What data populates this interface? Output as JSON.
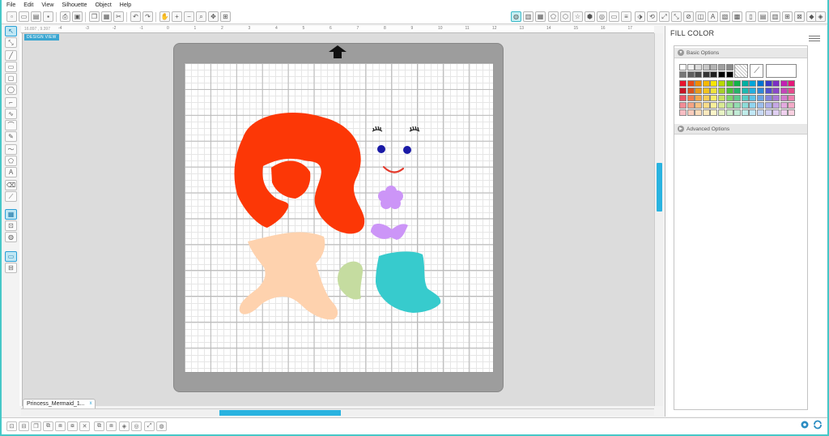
{
  "menu": [
    "File",
    "Edit",
    "View",
    "Silhouette",
    "Object",
    "Help"
  ],
  "ruler": {
    "coords": "16.897 , 9.397",
    "ticks": [
      "-4",
      "-3",
      "-2",
      "-1",
      "0",
      "1",
      "2",
      "3",
      "4",
      "5",
      "6",
      "7",
      "8",
      "9",
      "10",
      "11",
      "12",
      "13",
      "14",
      "15",
      "16",
      "17"
    ]
  },
  "design_view_label": "DESIGN VIEW",
  "document_tab": {
    "name": "Princess_Mermaid_1...",
    "close": "x"
  },
  "panel": {
    "title": "FILL COLOR",
    "basic_options": "Basic Options",
    "advanced_options": "Advanced Options"
  },
  "colors": {
    "accent": "#46c8c8",
    "scroll": "#29b3e0",
    "hair": "#fc3706",
    "skin": "#fed2ae",
    "tail": "#37cbcd",
    "fin": "#c5dca0",
    "shell": "#cc95f7",
    "eyes": "#1a1aa6",
    "mouth": "#e33a2c"
  },
  "palette": {
    "grays": [
      "#ffffff",
      "#f0f0f0",
      "#dcdcdc",
      "#c8c8c8",
      "#b4b4b4",
      "#a0a0a0",
      "#8c8c8c",
      "#777777",
      "#5f5f5f",
      "#4a4a4a",
      "#343434",
      "#1e1e1e",
      "#000000",
      "#000000"
    ],
    "hues": [
      [
        "#e8142e",
        "#e94a17",
        "#f08a00",
        "#f5b800",
        "#f7e500",
        "#b7d800",
        "#55c21a",
        "#10b34a",
        "#00b0a1",
        "#00a5d9",
        "#0073d2",
        "#3a3ac7",
        "#7c2fc4",
        "#c221b3",
        "#e6177a"
      ],
      [
        "#c81426",
        "#d9531e",
        "#e89a1b",
        "#f1c21c",
        "#efe23c",
        "#a6cf2a",
        "#4bc13a",
        "#26b36a",
        "#1cb9b0",
        "#23aee0",
        "#2f88d8",
        "#5350cf",
        "#8a47c9",
        "#c445b9",
        "#e64a8c"
      ],
      [
        "#ea5365",
        "#ee7a4c",
        "#f3a94d",
        "#f6cc55",
        "#f7ea6a",
        "#c7e15f",
        "#7cd26a",
        "#5fc98e",
        "#57cdc4",
        "#5cc2e8",
        "#6aa3e3",
        "#8585dc",
        "#a97ad6",
        "#d27ccd",
        "#ee7fae"
      ],
      [
        "#f18c95",
        "#f4a383",
        "#f7c282",
        "#f9dc88",
        "#faf09a",
        "#d9ea93",
        "#a7e09b",
        "#92dbb1",
        "#8cdcd8",
        "#90d5f0",
        "#9bbdec",
        "#acadeb",
        "#c5a7e5",
        "#e2aadf",
        "#f4aac8"
      ],
      [
        "#f7bdc3",
        "#f9ccbb",
        "#fbdcb9",
        "#fce9bd",
        "#fcf5c8",
        "#e8f3c4",
        "#cdeecb",
        "#c1ebd6",
        "#bfece9",
        "#c1e8f7",
        "#c8d9f5",
        "#d3d2f5",
        "#e0cff2",
        "#efd0ee",
        "#f9d1e1"
      ]
    ]
  }
}
